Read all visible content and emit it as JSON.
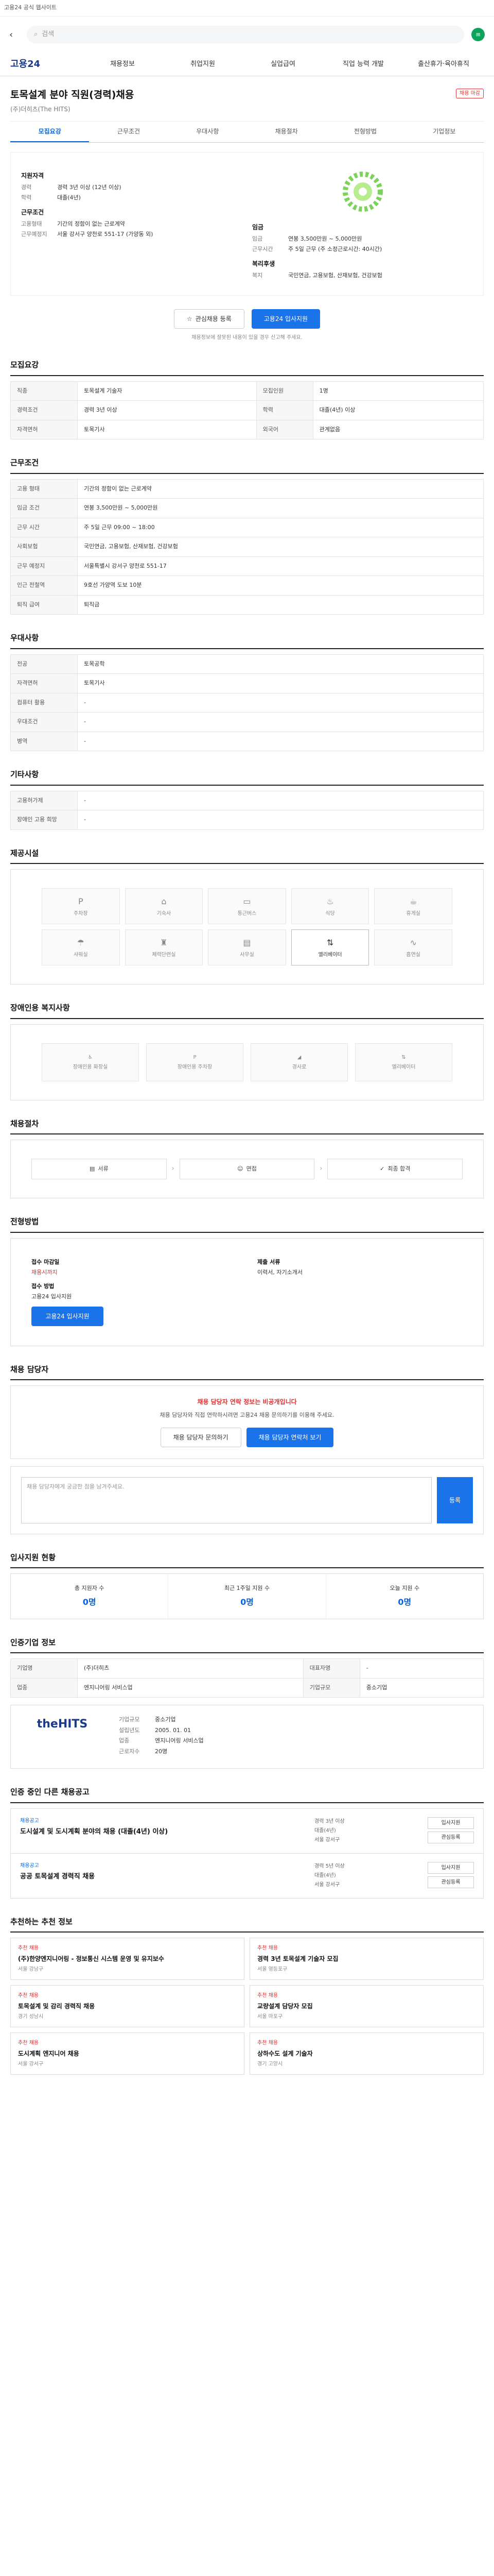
{
  "topbar": {
    "text": "고용24 공식 웹사이트"
  },
  "search": {
    "placeholder": "검색"
  },
  "gnb": {
    "logo": "고용24",
    "items": [
      "채용정보",
      "취업지원",
      "실업급여",
      "직업 능력 개발",
      "출산휴가·육아휴직"
    ]
  },
  "job": {
    "title": "토목설계 분야 직원(경력)채용",
    "company": "(주)더히츠(The HITS)",
    "badge": "채용 마감"
  },
  "tabs": [
    "모집요강",
    "근무조건",
    "우대사항",
    "채용절차",
    "전형방법",
    "기업정보"
  ],
  "summary": {
    "left_heading": "지원자격",
    "left_rows": [
      {
        "k": "경력",
        "v": "경력 3년 이상 (12년 이상)"
      },
      {
        "k": "학력",
        "v": "대졸(4년)"
      }
    ],
    "left_heading2": "근무조건",
    "left_rows2": [
      {
        "k": "고용형태",
        "v": "기간의 정함이 없는 근로계약"
      },
      {
        "k": "근무예정지",
        "v": "서울 강서구 양천로 551-17 (가양동 외)"
      }
    ],
    "right_heading": "임금",
    "right_rows": [
      {
        "k": "임금",
        "v": "연봉 3,500만원 ~ 5,000만원"
      },
      {
        "k": "근무시간",
        "v": "주 5일 근무 (주 소정근로시간: 40시간)"
      }
    ],
    "right_heading2": "복리후생",
    "right_rows2": [
      {
        "k": "복지",
        "v": "국민연금, 고용보험, 산재보험, 건강보험"
      }
    ]
  },
  "actions": {
    "interest": "관심채용 등록",
    "apply": "고용24 입사지원"
  },
  "notice": "채용정보에 잘못된 내용이 있을 경우 신고해 주세요.",
  "sections": {
    "recruit": "모집요강",
    "conditions": "근무조건",
    "preferred": "우대사항",
    "etc": "기타사항",
    "facilities": "제공시설",
    "welfare": "장애인용 복지사항",
    "steps": "채용절차",
    "method": "전형방법",
    "manager": "채용 담당자",
    "status": "입사지원 현황",
    "company": "인증기업 정보",
    "other_jobs": "인증 중인 다른 채용공고",
    "recommend": "추천하는 추천 정보"
  },
  "recruit_table": [
    {
      "k": "직종",
      "v": "토목설계 기술자"
    },
    {
      "k": "모집인원",
      "v": "1명"
    },
    {
      "k": "경력조건",
      "v": "경력 3년 이상"
    },
    {
      "k": "학력",
      "v": "대졸(4년) 이상"
    },
    {
      "k": "자격면허",
      "v": "토목기사"
    },
    {
      "k": "외국어",
      "v": "관계없음"
    }
  ],
  "conditions_table": [
    {
      "k": "고용 형태",
      "v": "기간의 정함이 없는 근로계약"
    },
    {
      "k": "임금 조건",
      "v": "연봉 3,500만원 ~ 5,000만원"
    },
    {
      "k": "근무 시간",
      "v": "주 5일 근무 09:00 ~ 18:00"
    },
    {
      "k": "사회보험",
      "v": "국민연금, 고용보험, 산재보험, 건강보험"
    },
    {
      "k": "근무 예정지",
      "v": "서울특별시 강서구 양천로 551-17"
    },
    {
      "k": "인근 전철역",
      "v": "9호선 가양역 도보 10분"
    },
    {
      "k": "퇴직 급여",
      "v": "퇴직금"
    }
  ],
  "preferred_table": [
    {
      "k": "전공",
      "v": "토목공학"
    },
    {
      "k": "자격면허",
      "v": "토목기사"
    },
    {
      "k": "컴퓨터 활용",
      "v": "-"
    },
    {
      "k": "우대조건",
      "v": "-"
    },
    {
      "k": "병역",
      "v": "-"
    }
  ],
  "etc_table": [
    {
      "k": "고용허가제",
      "v": "-"
    },
    {
      "k": "장애인 고용 희망",
      "v": "-"
    }
  ],
  "facilities": [
    "주차장",
    "기숙사",
    "통근버스",
    "식당",
    "휴게실",
    "샤워실",
    "체력단련실",
    "사무실",
    "엘리베이터",
    "흡연실"
  ],
  "welfare_items": [
    "장애인용 화장실",
    "장애인용 주차장",
    "경사로",
    "엘리베이터"
  ],
  "process": [
    "서류",
    "면접",
    "최종 합격"
  ],
  "apply": {
    "deadline_label": "접수 마감일",
    "deadline": "채용시까지",
    "method_label": "접수 방법",
    "method": "고용24 입사지원",
    "apply_btn": "고용24 입사지원",
    "docs_label": "제출 서류",
    "docs": "이력서, 자기소개서"
  },
  "manager": {
    "alert": "채용 담당자 연락 정보는 비공개입니다",
    "text": "채용 담당자와 직접 연락하시려면 고용24 채용 문의하기를 이용해 주세요.",
    "btn1": "채용 담당자 문의하기",
    "btn2": "채용 담당자 연락처 보기"
  },
  "qna": {
    "placeholder": "채용 담당자에게 궁금한 점을 남겨주세요.",
    "submit": "등록"
  },
  "status": [
    {
      "label": "총 지원자 수",
      "value": "0명"
    },
    {
      "label": "최근 1주일 지원 수",
      "value": "0명"
    },
    {
      "label": "오늘 지원 수",
      "value": "0명"
    }
  ],
  "company_table": [
    {
      "k": "기업명",
      "v": "(주)더히츠"
    },
    {
      "k": "대표자명",
      "v": "-"
    },
    {
      "k": "업종",
      "v": "엔지니어링 서비스업"
    },
    {
      "k": "기업규모",
      "v": "중소기업"
    }
  ],
  "company_card": {
    "logo": "theHITS",
    "rows": [
      {
        "k": "기업규모",
        "v": "중소기업"
      },
      {
        "k": "설립년도",
        "v": "2005. 01. 01"
      },
      {
        "k": "업종",
        "v": "엔지니어링 서비스업"
      },
      {
        "k": "근로자수",
        "v": "20명"
      }
    ]
  },
  "other_jobs": [
    {
      "cat": "채용공고",
      "title": "도시설계 및 도시계획 분야의 채용 (대졸(4년) 이상)",
      "meta": [
        "경력 3년 이상",
        "대졸(4년)",
        "서울 강서구"
      ],
      "btns": [
        "입사지원",
        "관심등록"
      ]
    },
    {
      "cat": "채용공고",
      "title": "공공 토목설계 경력직 채용",
      "meta": [
        "경력 5년 이상",
        "대졸(4년)",
        "서울 강서구"
      ],
      "btns": [
        "입사지원",
        "관심등록"
      ]
    }
  ],
  "recommend": [
    {
      "cat": "추천 채용",
      "title": "(주)한양엔지니어링 - 정보통신 시스템 운영 및 유지보수",
      "meta": "서울 강남구"
    },
    {
      "cat": "추천 채용",
      "title": "경력 3년 토목설계 기술자 모집",
      "meta": "서울 영등포구"
    },
    {
      "cat": "추천 채용",
      "title": "토목설계 및 감리 경력직 채용",
      "meta": "경기 성남시"
    },
    {
      "cat": "추천 채용",
      "title": "교량설계 담당자 모집",
      "meta": "서울 마포구"
    },
    {
      "cat": "추천 채용",
      "title": "도시계획 엔지니어 채용",
      "meta": "서울 강서구"
    },
    {
      "cat": "추천 채용",
      "title": "상하수도 설계 기술자",
      "meta": "경기 고양시"
    }
  ]
}
